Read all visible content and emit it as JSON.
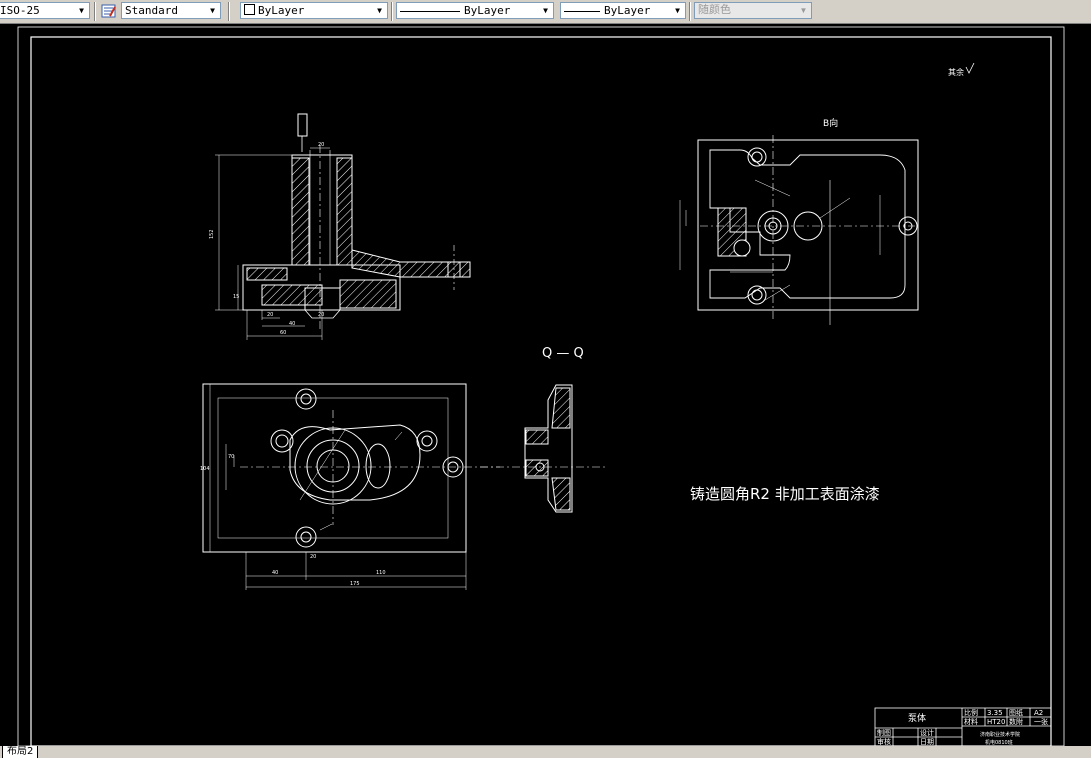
{
  "toolbar": {
    "dimstyle_value": "ISO-25",
    "textstyle_icon": "text-style-icon",
    "textstyle_value": "Standard",
    "layer_value": "ByLayer",
    "linetype_value": "ByLayer",
    "lineweight_value": "ByLayer",
    "color_value": "随颜色"
  },
  "drawing": {
    "view_b_label": "B向",
    "section_label": "Q — Q",
    "note_text": "铸造圆角R2 非加工表面涂漆",
    "roughness_note": "其余",
    "colors": {
      "background": "#000000",
      "lines": "#ffffff",
      "hatch": "#ffffff"
    },
    "front_view_dims": {
      "d1": "20",
      "d2": "152",
      "d3": "15",
      "d4": "20",
      "d5": "40",
      "d6": "60",
      "d7": "20"
    },
    "plan_view_dims": {
      "d1": "40",
      "d2": "110",
      "d3": "175",
      "d4": "104",
      "d5": "70",
      "d6": "20"
    },
    "title_block": {
      "part_name": "泵体",
      "scale_label": "比例",
      "scale_value": "3.35",
      "sheet_label": "图纸",
      "sheet_value": "A2",
      "material_label": "材料",
      "material_value": "HT20",
      "count_label": "数附",
      "count_value": "一张",
      "drawn_label": "制图",
      "reviewed_label": "审核",
      "design_label": "设计",
      "date_label": "日期",
      "school_text": "济南职业技术学院",
      "class_text": "机电0810班"
    }
  },
  "tabs": {
    "layout_tab": "布局2"
  }
}
